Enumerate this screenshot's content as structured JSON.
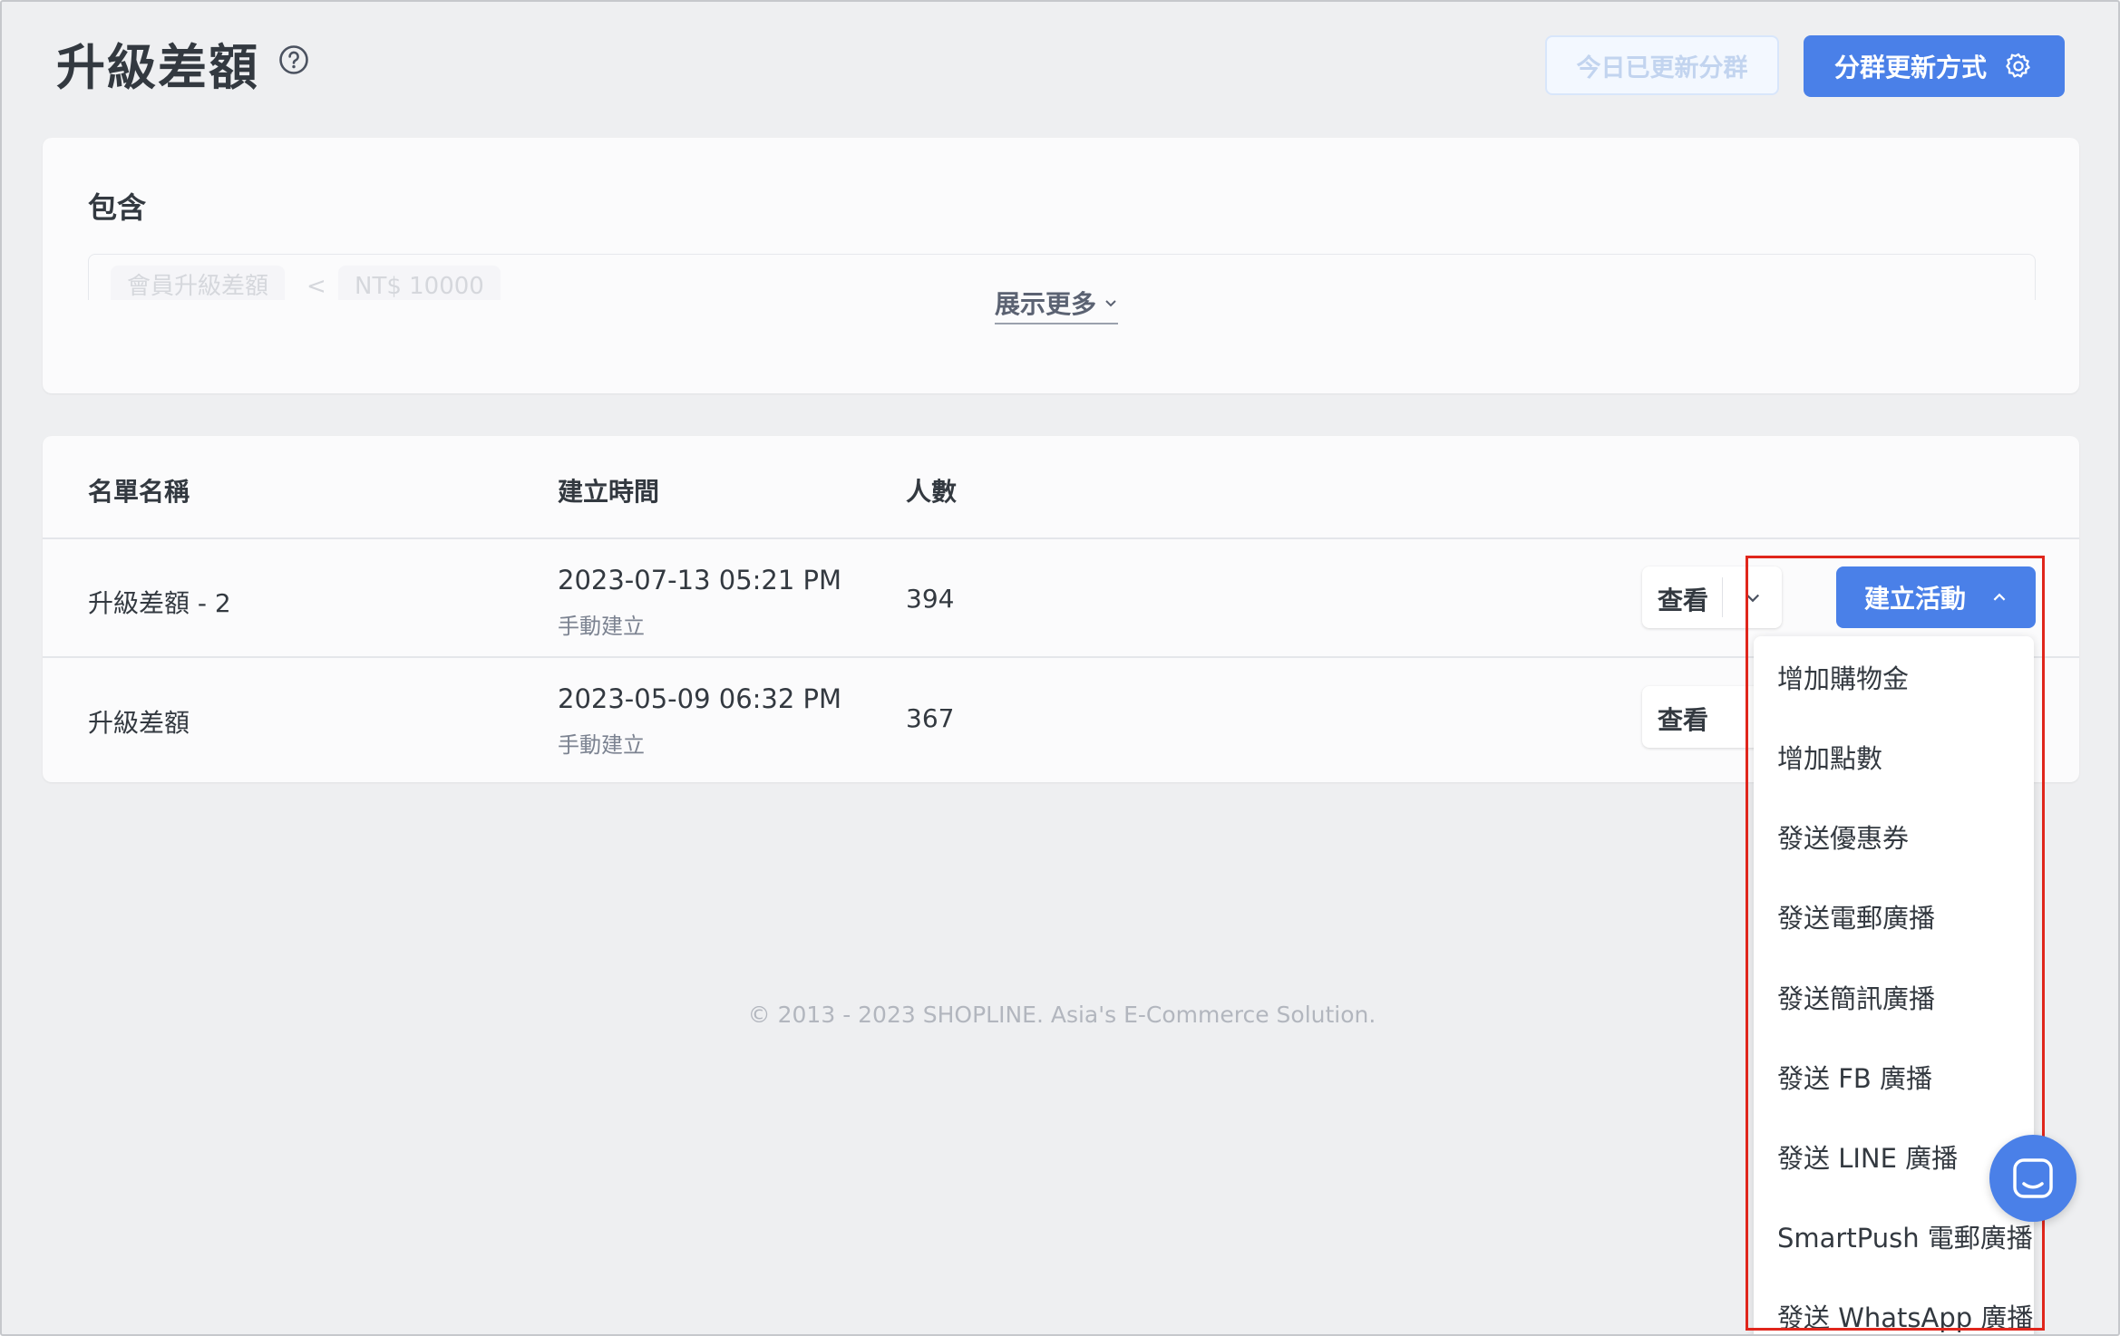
{
  "header": {
    "title": "升級差額",
    "updated_today_label": "今日已更新分群",
    "update_method_label": "分群更新方式"
  },
  "include_card": {
    "label": "包含",
    "condition": {
      "field": "會員升級差額",
      "operator": "<",
      "value": "NT$ 10000"
    },
    "show_more_label": "展示更多"
  },
  "list": {
    "columns": [
      "名單名稱",
      "建立時間",
      "人數"
    ],
    "rows": [
      {
        "name": "升級差額 - 2",
        "created_at": "2023-07-13 05:21 PM",
        "created_by": "手動建立",
        "count": "394",
        "view_label": "查看"
      },
      {
        "name": "升級差額",
        "created_at": "2023-05-09 06:32 PM",
        "created_by": "手動建立",
        "count": "367",
        "view_label": "查看"
      }
    ],
    "create_activity_label": "建立活動"
  },
  "dropdown": {
    "items": [
      "增加購物金",
      "增加點數",
      "發送優惠券",
      "發送電郵廣播",
      "發送簡訊廣播",
      "發送 FB 廣播",
      "發送 LINE 廣播",
      "SmartPush 電郵廣播",
      "發送 WhatsApp 廣播"
    ]
  },
  "footer": {
    "text": "© 2013 - 2023 SHOPLINE. Asia's E-Commerce Solution."
  },
  "colors": {
    "primary": "#4a80e8",
    "highlight": "#e0261c",
    "background": "#eeeff1"
  },
  "icons": [
    "help-icon",
    "gear-icon",
    "chevron-down-icon",
    "chevron-up-icon",
    "chat-icon"
  ]
}
